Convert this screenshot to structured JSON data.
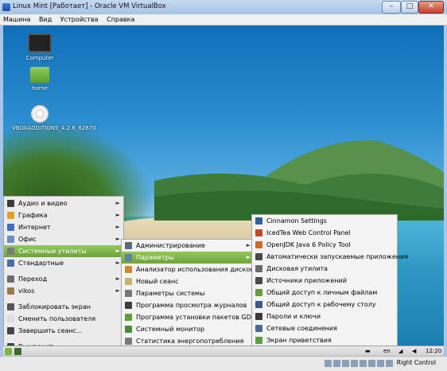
{
  "window": {
    "title": "Linux Mint [Работает] - Oracle VM VirtualBox",
    "min": "–",
    "max": "□",
    "close": "✕"
  },
  "menubar": [
    "Машина",
    "Вид",
    "Устройства",
    "Справка"
  ],
  "desktop_icons": [
    {
      "label": "Computer",
      "icon": "monitor-icon"
    },
    {
      "label": "home",
      "icon": "folder-icon"
    },
    {
      "label": "VBOXADDITIONS_4.2.6_82870",
      "icon": "cd-icon"
    }
  ],
  "main_menu": {
    "categories": [
      {
        "label": "Аудио и видео",
        "color": "#3b3b3b"
      },
      {
        "label": "Графика",
        "color": "#e0a030"
      },
      {
        "label": "Интернет",
        "color": "#3a6fc4"
      },
      {
        "label": "Офис",
        "color": "#6a8fc0"
      },
      {
        "label": "Системные утилиты",
        "color": "#7a7a7a"
      },
      {
        "label": "Стандартные",
        "color": "#4a6f9a"
      }
    ],
    "places": [
      {
        "label": "Переход",
        "color": "#6d6d6d"
      },
      {
        "label": "vikos",
        "color": "#9a7a4a"
      }
    ],
    "session": [
      {
        "label": "Заблокировать экран",
        "color": "#555555"
      },
      {
        "label": "Сменить пользователя",
        "color": "#dddddd"
      },
      {
        "label": "Завершить сеанс...",
        "color": "#444444"
      },
      {
        "label": "Выключить...",
        "color": "#444444"
      }
    ]
  },
  "sub_menu": [
    {
      "label": "Администрирование",
      "color": "#5a6b7d",
      "arrow": true
    },
    {
      "label": "Параметры",
      "color": "#5a7fa8",
      "arrow": true
    },
    {
      "label": "Анализатор использования дисков",
      "color": "#d08a2a",
      "arrow": false
    },
    {
      "label": "Новый сеанс",
      "color": "#c9b26b",
      "arrow": false
    },
    {
      "label": "Параметры системы",
      "color": "#777777",
      "arrow": false
    },
    {
      "label": "Программа просмотра журналов",
      "color": "#3f3f3f",
      "arrow": false
    },
    {
      "label": "Программа установки пакетов GDebi",
      "color": "#5f9e3a",
      "arrow": false
    },
    {
      "label": "Системный монитор",
      "color": "#4a8a3a",
      "arrow": false
    },
    {
      "label": "Статистика энергопотребления",
      "color": "#7a7a7a",
      "arrow": false
    }
  ],
  "sub2_menu": [
    {
      "label": "Cinnamon Settings",
      "color": "#2f5f9f"
    },
    {
      "label": "IcedTea Web Control Panel",
      "color": "#c04a2a"
    },
    {
      "label": "OpenJDK Java 6 Policy Tool",
      "color": "#d06a2a"
    },
    {
      "label": "Автоматически запускаемые приложения",
      "color": "#4a4a4a"
    },
    {
      "label": "Дисковая утилита",
      "color": "#6a6a6a"
    },
    {
      "label": "Источники приложений",
      "color": "#4a4a4a"
    },
    {
      "label": "Общий доступ к личным файлам",
      "color": "#6a9a3a"
    },
    {
      "label": "Общий доступ к рабочему столу",
      "color": "#3a5a8a"
    },
    {
      "label": "Пароли и ключи",
      "color": "#3a3a3a"
    },
    {
      "label": "Сетевые соединения",
      "color": "#4a6a9a"
    },
    {
      "label": "Экран приветствия",
      "color": "#5aa03a"
    }
  ],
  "taskbar": {
    "language": "en",
    "clock": "12:20"
  },
  "statusbar": {
    "host_key": "Right Control"
  }
}
